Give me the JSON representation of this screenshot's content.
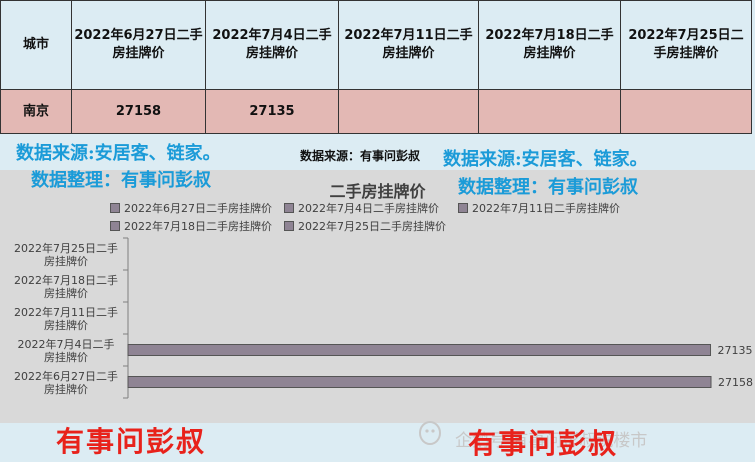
{
  "table": {
    "headers": [
      "城市",
      "2022年6月27日二手房挂牌价",
      "2022年7月4日二手房挂牌价",
      "2022年7月11日二手房挂牌价",
      "2022年7月18日二手房挂牌价",
      "2022年7月25日二手房挂牌价"
    ],
    "rows": [
      [
        "南京",
        "27158",
        "27135",
        "",
        "",
        ""
      ]
    ]
  },
  "watermarks": {
    "source_left": "数据来源:安居客、链家。",
    "arrange_left": "数据整理：有事问彭叔",
    "source_center": "数据来源：有事问彭叔",
    "source_right": "数据来源:安居客、链家。",
    "arrange_right": "数据整理：有事问彭叔",
    "bottom_left": "有事问彭叔",
    "bottom_right": "有事问彭叔",
    "wechat_text": "企鹅号 有事问彭叔说楼市"
  },
  "chart_data": {
    "type": "bar",
    "orientation": "horizontal",
    "title": "二手房挂牌价",
    "legend": [
      "2022年6月27日二手房挂牌价",
      "2022年7月4日二手房挂牌价",
      "2022年7月11日二手房挂牌价",
      "2022年7月18日二手房挂牌价",
      "2022年7月25日二手房挂牌价"
    ],
    "legend_position": "top",
    "categories": [
      "2022年6月27日二手房挂牌价",
      "2022年7月4日二手房挂牌价",
      "2022年7月11日二手房挂牌价",
      "2022年7月18日二手房挂牌价",
      "2022年7月25日二手房挂牌价"
    ],
    "values": [
      27158,
      27135,
      null,
      null,
      null
    ],
    "data_labels": [
      "27158",
      "27135",
      "",
      "",
      ""
    ],
    "bar_color": "#8f8494",
    "xlim": [
      0,
      27158
    ]
  }
}
